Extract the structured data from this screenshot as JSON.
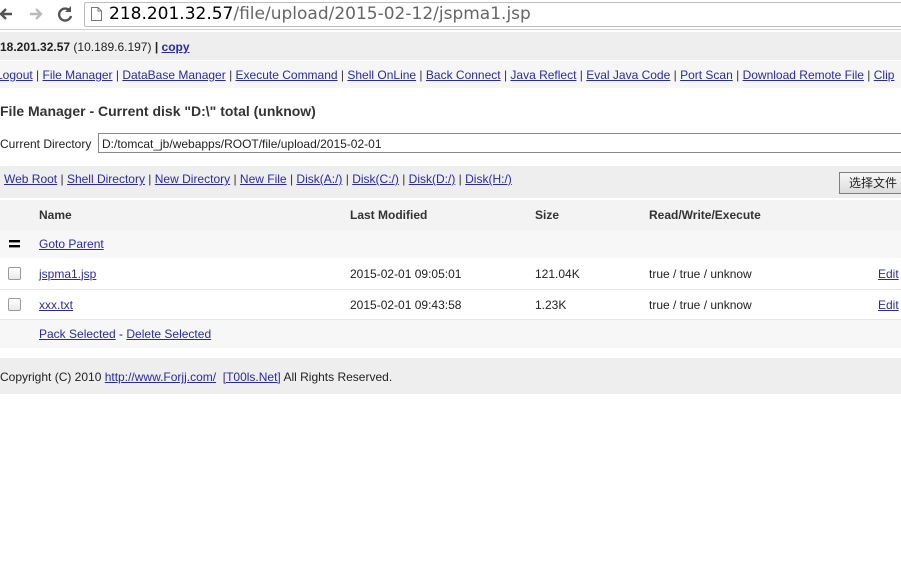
{
  "browser": {
    "url_host": "218.201.32.57",
    "url_path": "/file/upload/2015-02-12/jspma1.jsp"
  },
  "info": {
    "host": "18.201.32.57",
    "ip": "(10.189.6.197)",
    "sep": " | ",
    "copy_label": "copy"
  },
  "toolbar": {
    "items": [
      "Logout",
      "File Manager",
      "DataBase Manager",
      "Execute Command",
      "Shell OnLine",
      "Back Connect",
      "Java Reflect",
      "Eval Java Code",
      "Port Scan",
      "Download Remote File",
      "Clip"
    ]
  },
  "file_manager": {
    "title": "File Manager - Current disk \"D:\\\" total (unknow)",
    "current_dir_label": "Current Directory",
    "current_dir_value": "D:/tomcat_jb/webapps/ROOT/file/upload/2015-02-01"
  },
  "diskbar": {
    "items": [
      "Web Root",
      "Shell Directory",
      "New Directory",
      "New File",
      "Disk(A:/)",
      "Disk(C:/)",
      "Disk(D:/)",
      "Disk(H:/)"
    ],
    "file_button": "选择文件"
  },
  "table": {
    "headers": {
      "name": "Name",
      "modified": "Last Modified",
      "size": "Size",
      "rwx": "Read/Write/Execute"
    },
    "parent_label": "Goto Parent",
    "rows": [
      {
        "name": "jspma1.jsp",
        "modified": "2015-02-01 09:05:01",
        "size": "121.04K",
        "rwx": "true / true / unknow",
        "action": "Edit"
      },
      {
        "name": "xxx.txt",
        "modified": "2015-02-01 09:43:58",
        "size": "1.23K",
        "rwx": "true / true / unknow",
        "action": "Edit"
      }
    ],
    "pack_label": "Pack Selected",
    "dash": " - ",
    "delete_label": "Delete Selected"
  },
  "footer": {
    "prefix": "Copyright (C) 2010 ",
    "link1": "http://www.Forjj.com/",
    "link2": "[T00ls.Net]",
    "suffix": " All Rights Reserved."
  },
  "colors": {
    "link": "#2a2aa5",
    "bar_bg": "#eeeeee"
  }
}
